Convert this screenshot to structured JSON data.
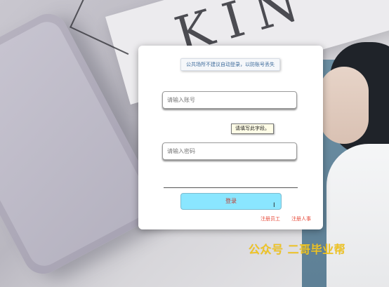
{
  "background": {
    "magazine_letters": "KIN"
  },
  "notice": {
    "text": "公共场所不建议自动登录，以防账号丢失"
  },
  "account_field": {
    "placeholder": "请输入账号",
    "value": ""
  },
  "validation_tip": {
    "text": "请填写此字段。"
  },
  "password_field": {
    "placeholder": "请输入密码",
    "value": ""
  },
  "login_button": {
    "label": "登录"
  },
  "links": {
    "register_employee": "注册员工",
    "register_hr": "注册人事"
  },
  "watermark": {
    "text": "公众号 二哥毕业帮"
  },
  "colors": {
    "button_bg": "#8ae6ff",
    "link": "#e74c3c",
    "watermark": "#f0c423"
  }
}
